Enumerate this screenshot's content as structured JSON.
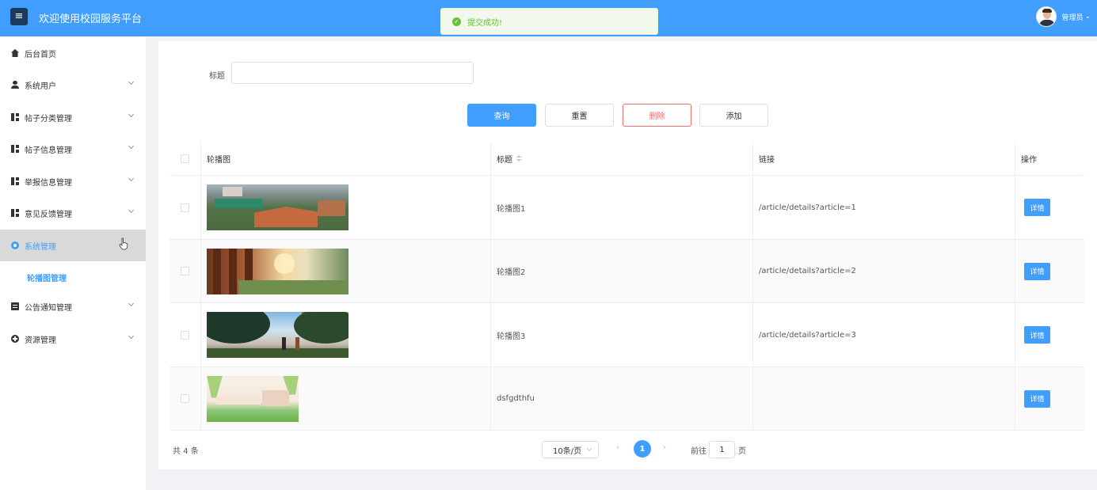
{
  "header": {
    "menu_glyph": "≡",
    "title": "欢迎使用校园服务平台",
    "toast": {
      "icon": "✓",
      "text": "提交成功!"
    },
    "user": {
      "name": "管理员",
      "caret": "⌄"
    }
  },
  "sidebar": {
    "items": [
      {
        "label": "后台首页",
        "icon": "home-icon"
      },
      {
        "label": "系统用户",
        "icon": "user-icon"
      },
      {
        "label": "帖子分类管理",
        "icon": "grid-icon"
      },
      {
        "label": "帖子信息管理",
        "icon": "grid-icon"
      },
      {
        "label": "举报信息管理",
        "icon": "grid-icon"
      },
      {
        "label": "意见反馈管理",
        "icon": "grid-icon"
      },
      {
        "label": "系统管理",
        "icon": "gear-icon",
        "active": true
      },
      {
        "label": "公告通知管理",
        "icon": "document-icon"
      },
      {
        "label": "资源管理",
        "icon": "plus-circle-icon"
      }
    ],
    "submenu": {
      "label": "轮播图管理"
    }
  },
  "search": {
    "label": "标题",
    "value": "",
    "placeholder": ""
  },
  "actions": {
    "query": "查询",
    "reset": "重置",
    "delete": "删除",
    "add": "添加"
  },
  "table": {
    "headers": {
      "image": "轮播图",
      "title": "标题",
      "link": "链接",
      "ops": "操作"
    },
    "rows": [
      {
        "title": "轮播图1",
        "link": "/article/details?article=1",
        "detail": "详情"
      },
      {
        "title": "轮播图2",
        "link": "/article/details?article=2",
        "detail": "详情"
      },
      {
        "title": "轮播图3",
        "link": "/article/details?article=3",
        "detail": "详情"
      },
      {
        "title": "dsfgdthfu",
        "link": "",
        "detail": "详情"
      }
    ]
  },
  "pagination": {
    "total": "共 4 条",
    "page_size": "10条/页",
    "prev": "‹",
    "current": "1",
    "next": "›",
    "goto_label": "前往",
    "goto_value": "1",
    "page_suffix": "页"
  },
  "colors": {
    "primary": "#409eff",
    "danger": "#f56c6c",
    "success": "#67c23a"
  }
}
